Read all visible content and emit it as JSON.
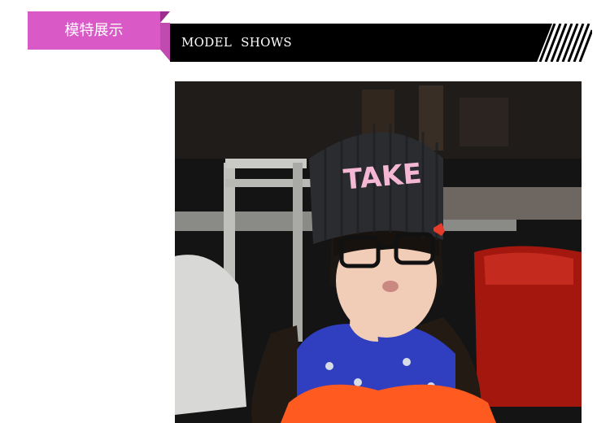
{
  "header": {
    "tab_label": "模特展示",
    "bar_title": "MODEL   SHOWS"
  },
  "photo": {
    "hat_text": "TAKE"
  },
  "colors": {
    "tab_pink": "#d959c7",
    "bar_black": "#000000"
  }
}
